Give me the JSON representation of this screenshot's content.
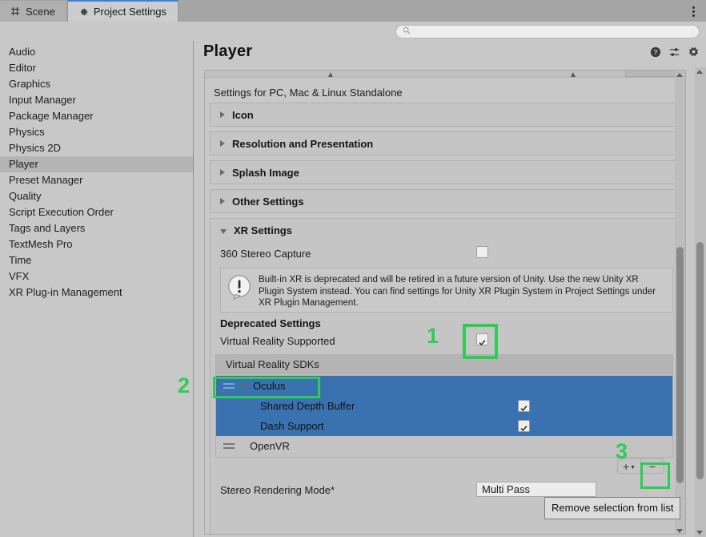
{
  "window": {
    "tabs": [
      {
        "label": "Scene",
        "icon": "grid-icon",
        "active": false
      },
      {
        "label": "Project Settings",
        "icon": "gear-icon",
        "active": true
      }
    ],
    "kebab_icon": "more-options-icon"
  },
  "search": {
    "value": "",
    "placeholder": "",
    "icon": "search-icon"
  },
  "sidebar": {
    "items": [
      {
        "label": "Audio",
        "selected": false
      },
      {
        "label": "Editor",
        "selected": false
      },
      {
        "label": "Graphics",
        "selected": false
      },
      {
        "label": "Input Manager",
        "selected": false
      },
      {
        "label": "Package Manager",
        "selected": false
      },
      {
        "label": "Physics",
        "selected": false
      },
      {
        "label": "Physics 2D",
        "selected": false
      },
      {
        "label": "Player",
        "selected": true
      },
      {
        "label": "Preset Manager",
        "selected": false
      },
      {
        "label": "Quality",
        "selected": false
      },
      {
        "label": "Script Execution Order",
        "selected": false
      },
      {
        "label": "Tags and Layers",
        "selected": false
      },
      {
        "label": "TextMesh Pro",
        "selected": false
      },
      {
        "label": "Time",
        "selected": false
      },
      {
        "label": "VFX",
        "selected": false
      },
      {
        "label": "XR Plug-in Management",
        "selected": false
      }
    ]
  },
  "panel": {
    "title": "Player",
    "icons": [
      {
        "name": "help-icon",
        "glyph": "?"
      },
      {
        "name": "preset-icon",
        "glyph": "sliders"
      },
      {
        "name": "settings-gear-icon",
        "glyph": "gear"
      }
    ],
    "settings_for": "Settings for PC, Mac & Linux Standalone",
    "sections": [
      {
        "label": "Icon",
        "expanded": false
      },
      {
        "label": "Resolution and Presentation",
        "expanded": false
      },
      {
        "label": "Splash Image",
        "expanded": false
      },
      {
        "label": "Other Settings",
        "expanded": false
      },
      {
        "label": "XR Settings",
        "expanded": true
      }
    ],
    "xr": {
      "stereo_capture_label": "360 Stereo Capture",
      "stereo_capture_checked": false,
      "warning_icon": "warning-speech-icon",
      "warning_text": "Built-in XR is deprecated and will be retired in a future version of Unity. Use the new Unity XR Plugin System instead. You can find settings for Unity XR Plugin System in Project Settings under XR Plugin Management.",
      "deprecated_heading": "Deprecated Settings",
      "vr_supported_label": "Virtual Reality Supported",
      "vr_supported_checked": true,
      "sdk_list_header": "Virtual Reality SDKs",
      "sdk_items": [
        {
          "label": "Oculus",
          "selected": true,
          "expanded": true,
          "children": [
            {
              "label": "Shared Depth Buffer",
              "checked": true
            },
            {
              "label": "Dash Support",
              "checked": true
            }
          ]
        },
        {
          "label": "OpenVR",
          "selected": false,
          "expanded": false,
          "children": []
        }
      ],
      "add_button_label": "+",
      "remove_button_label": "−",
      "stereo_rendering_label": "Stereo Rendering Mode*",
      "stereo_rendering_value": "Multi Pass"
    }
  },
  "tooltip": {
    "text": "Remove selection from list"
  },
  "annotations": [
    {
      "number": "1",
      "target": "virtual-reality-supported-checkbox"
    },
    {
      "number": "2",
      "target": "oculus-sdk-entry"
    },
    {
      "number": "3",
      "target": "remove-sdk-button"
    }
  ],
  "colors": {
    "annotation_green": "#2ecc57",
    "selection_blue": "#3a72b0",
    "panel_background": "#c8c8c8"
  }
}
